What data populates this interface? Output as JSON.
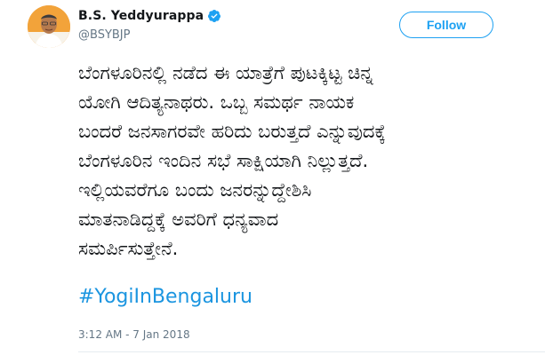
{
  "author": {
    "display_name": "B.S. Yeddyurappa",
    "handle": "@BSYBJP",
    "verified": true,
    "avatar_icon": "profile-photo",
    "verified_icon": "verified-badge-icon"
  },
  "actions": {
    "follow_label": "Follow"
  },
  "tweet": {
    "lines": [
      "ಬೆಂಗಳೂರಿನಲ್ಲಿ ನಡೆದ ಈ ಯಾತ್ರೆಗೆ ಪುಟಕ್ಕಿಟ್ಟ ಚಿನ್ನ",
      "ಯೋಗಿ ಆದಿತ್ಯನಾಥರು. ಒಬ್ಬ ಸಮರ್ಥ ನಾಯಕ",
      "ಬಂದರೆ ಜನಸಾಗರವೇ ಹರಿದು ಬರುತ್ತದೆ ಎನ್ನುವುದಕ್ಕೆ",
      "ಬೆಂಗಳೂರಿನ ಇಂದಿನ ಸಭೆ ಸಾಕ್ಷಿಯಾಗಿ ನಿಲ್ಲುತ್ತದೆ.",
      "ಇಲ್ಲಿಯವರೆಗೂ ಬಂದು ಜನರನ್ನುದ್ದೇಶಿಸಿ",
      "ಮಾತನಾಡಿದ್ದಕ್ಕೆ ಅವರಿಗೆ ಧನ್ಯವಾದ",
      "ಸಮರ್ಪಿಸುತ್ತೇನೆ."
    ],
    "hashtag": "#YogiInBengaluru",
    "timestamp": "3:12 AM - 7 Jan 2018"
  },
  "colors": {
    "accent": "#1da1f2",
    "hashtag": "#1b95e0",
    "muted": "#657786",
    "text": "#14171a"
  }
}
